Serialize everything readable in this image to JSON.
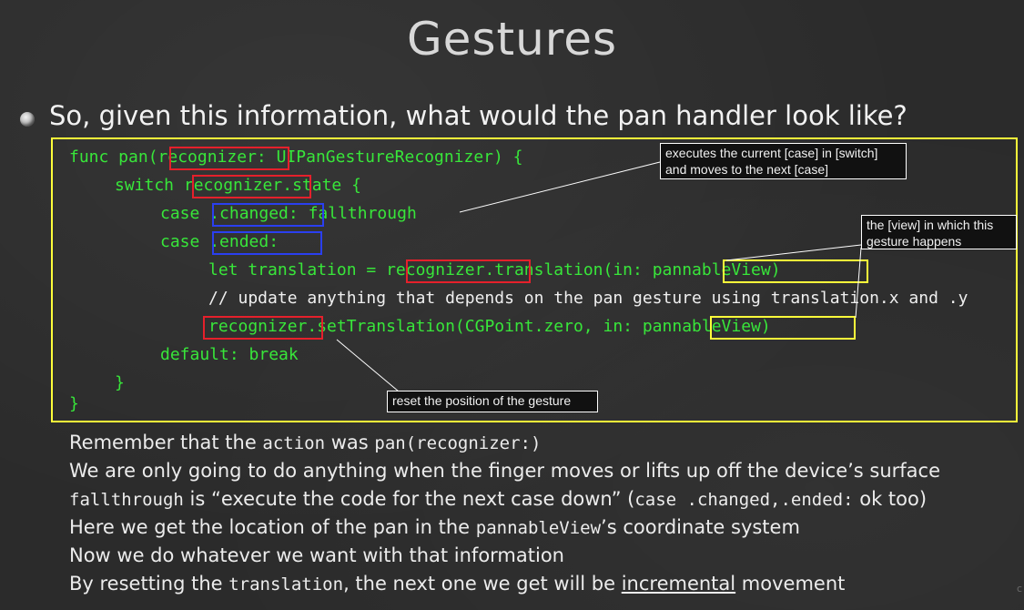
{
  "slide": {
    "title": "Gestures",
    "bullet": "So, given this information, what would the pan handler look like?"
  },
  "code": {
    "line1": {
      "a": "func pan(",
      "b": "recognizer",
      "c": ": UIPanGestureRecognizer) {"
    },
    "line2": {
      "a": "switch ",
      "b": "recognizer",
      "c": ".state {"
    },
    "line3": {
      "a": "case ",
      "b": ".changed:",
      "c": " fallthrough"
    },
    "line4": {
      "a": "case ",
      "b": ".ended:"
    },
    "line5": {
      "a": "let translation = ",
      "b": "recognizer",
      "c": ".translation(in: ",
      "d": "pannableView",
      "e": ")"
    },
    "line6": "// update anything that depends on the pan gesture using translation.x and .y",
    "line7": {
      "a": "recognizer",
      "b": ".setTranslation(CGPoint.zero, in: ",
      "c": "pannableView",
      "d": ")"
    },
    "line8": "default: break",
    "line9": "}",
    "line10": "}"
  },
  "callouts": {
    "fallthrough": "executes the current [case] in [switch]\nand moves to the next [case]",
    "view": "the [view] in which this\ngesture happens",
    "reset": "reset the position of the gesture"
  },
  "notes": {
    "n1": {
      "a": "Remember that the ",
      "b": "action",
      "c": " was ",
      "d": "pan(recognizer:)"
    },
    "n2": "We are only going to do anything when the finger moves or lifts up off the device’s surface",
    "n3": {
      "a": "fallthrough",
      "b": " is “execute the code for the next case down” (",
      "c": "case .changed,.ended:",
      "d": " ok too)"
    },
    "n4": {
      "a": "Here we get the location of the pan in the ",
      "b": "pannableView",
      "c": "’s coordinate system"
    },
    "n5": "Now we do whatever we want with that information",
    "n6": {
      "a": "By resetting the ",
      "b": "translation",
      "c": ", the next one we get will be ",
      "d": "incremental",
      "e": " movement"
    }
  },
  "colors": {
    "background": "#2b2b2b",
    "code_green": "#38e63a",
    "box_yellow": "#ffff3a",
    "highlight_red": "#e5202b",
    "highlight_blue": "#2a3ff0"
  }
}
